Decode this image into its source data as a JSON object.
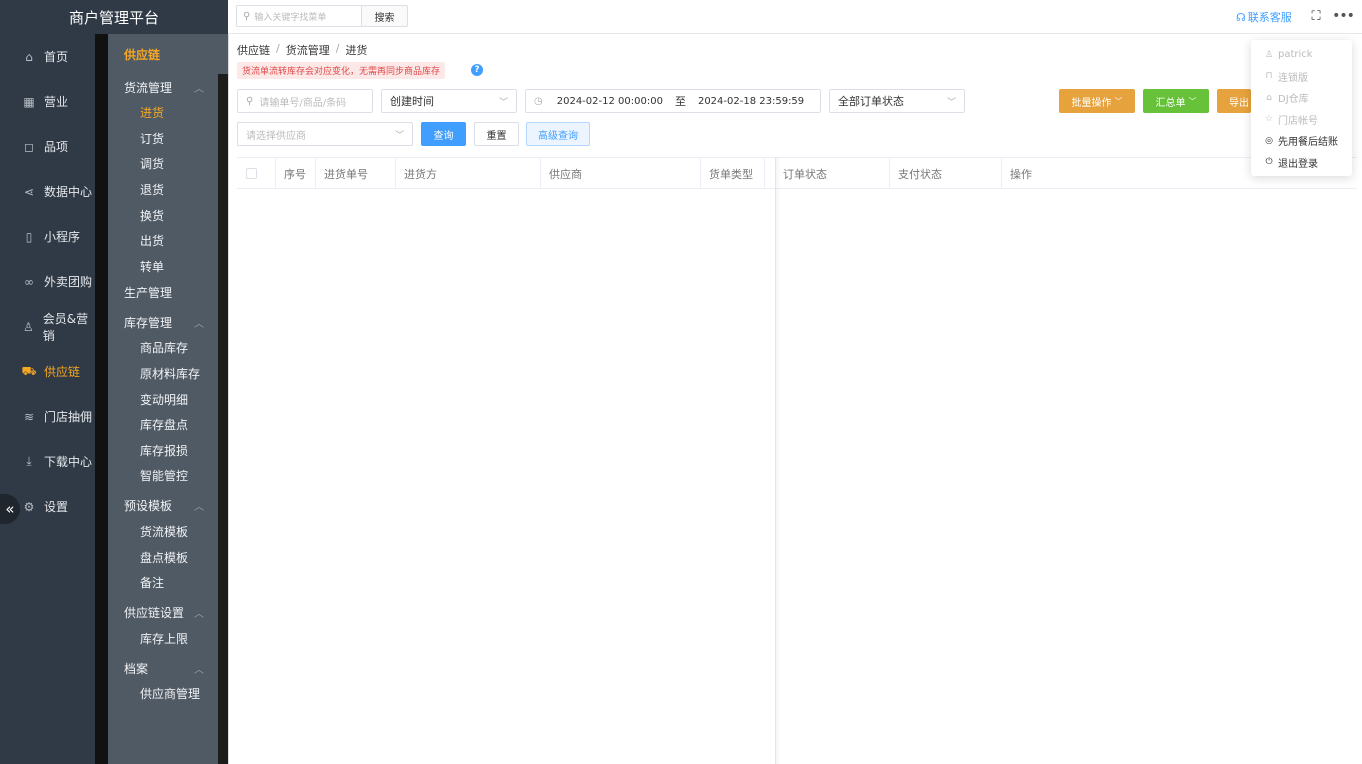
{
  "brand": "商户管理平台",
  "topbar": {
    "search_placeholder": "输入关键字找菜单",
    "search_button": "搜索",
    "contact": "联系客服"
  },
  "nav1": [
    {
      "label": "首页",
      "icon": "home-icon"
    },
    {
      "label": "营业",
      "icon": "calendar-icon"
    },
    {
      "label": "品项",
      "icon": "bag-icon"
    },
    {
      "label": "数据中心",
      "icon": "share-icon"
    },
    {
      "label": "小程序",
      "icon": "phone-icon"
    },
    {
      "label": "外卖团购",
      "icon": "bike-icon"
    },
    {
      "label": "会员&营销",
      "icon": "user-icon"
    },
    {
      "label": "供应链",
      "icon": "truck-icon"
    },
    {
      "label": "门店抽佣",
      "icon": "database-icon"
    },
    {
      "label": "下载中心",
      "icon": "download-icon"
    },
    {
      "label": "设置",
      "icon": "gear-icon"
    }
  ],
  "nav2": {
    "head": "供应链",
    "groups": [
      {
        "label": "货流管理",
        "items": [
          "进货",
          "订货",
          "调货",
          "退货",
          "换货",
          "出货",
          "转单"
        ]
      },
      {
        "label": "生产管理",
        "items": []
      },
      {
        "label": "库存管理",
        "items": [
          "商品库存",
          "原材料库存",
          "变动明细",
          "库存盘点",
          "库存报损",
          "智能管控"
        ]
      },
      {
        "label": "预设模板",
        "items": [
          "货流模板",
          "盘点模板",
          "备注"
        ]
      },
      {
        "label": "供应链设置",
        "items": [
          "库存上限"
        ]
      },
      {
        "label": "档案",
        "items": [
          "供应商管理"
        ]
      }
    ]
  },
  "breadcrumb": [
    "供应链",
    "货流管理",
    "进货"
  ],
  "warning": "货流单流转库存会对应变化，无需再同步商品库存",
  "filters": {
    "order_placeholder": "请输单号/商品/条码",
    "time_type": "创建时间",
    "date_start": "2024-02-12 00:00:00",
    "date_to": "至",
    "date_end": "2024-02-18 23:59:59",
    "status": "全部订单状态",
    "supplier_placeholder": "请选择供应商",
    "query": "查询",
    "reset": "重置",
    "advanced": "高级查询"
  },
  "actions": {
    "batch": "批量操作",
    "summary": "汇总单",
    "export": "导出"
  },
  "table_headers": [
    "序号",
    "进货单号",
    "进货方",
    "供应商",
    "货单类型",
    "订单状态",
    "支付状态",
    "操作"
  ],
  "dropdown": [
    {
      "label": "patrick",
      "icon": "user-icon",
      "disabled": true
    },
    {
      "label": "连锁版",
      "icon": "bookmark-icon",
      "disabled": true
    },
    {
      "label": "DJ仓库",
      "icon": "home-icon",
      "disabled": true
    },
    {
      "label": "门店帐号",
      "icon": "star-icon",
      "disabled": true
    },
    {
      "label": "先用餐后结账",
      "icon": "target-icon",
      "disabled": false
    },
    {
      "label": "退出登录",
      "icon": "power-icon",
      "disabled": false
    }
  ],
  "colors": {
    "sidebar": "#2f3a46",
    "sidebar2": "#505a65",
    "accent": "#f5a623",
    "primary": "#409eff",
    "orange": "#e6a23c",
    "green": "#67c23a"
  }
}
